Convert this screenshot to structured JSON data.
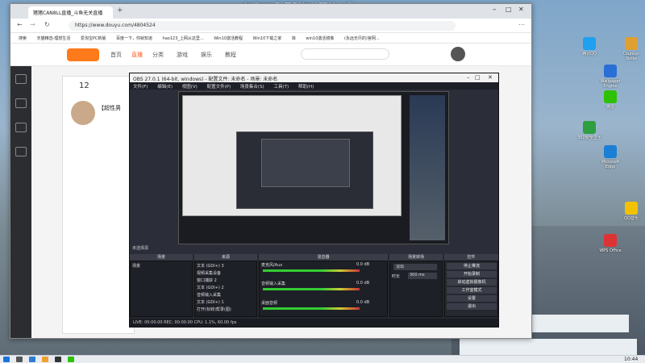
{
  "overlay_text": "在吧WX群里群包分配给大家",
  "browser": {
    "tab_title": "猪猪CAN8LL直播_斗鱼无关直播",
    "url": "https://www.douyu.com/4804524",
    "favorites": [
      "搜索",
      "天猫精选-理想生活",
      "爱淘宝PC新版",
      "百度一下，你就知道",
      "hao123_上网从这里...",
      "Win10激活教程",
      "Win10下载之家",
      "库",
      "win10激活镜像",
      "(永远无尽的)官网..."
    ],
    "nav": [
      "首页",
      "直播",
      "分类",
      "游戏",
      "娱乐",
      "教程"
    ],
    "room_number": "12",
    "room_title": "【超性男"
  },
  "obs": {
    "title": "OBS 27.0.1 (64-bit, windows) - 配置文件: 未命名 - 场景: 未命名",
    "menu": [
      "文件(F)",
      "编辑(E)",
      "视图(V)",
      "配置文件(P)",
      "场景集合(S)",
      "工具(T)",
      "帮助(H)"
    ],
    "no_source": "未选择源",
    "panels": {
      "scenes": "场景",
      "sources": "来源",
      "mixer": "混音器",
      "transitions": "场景转场",
      "controls": "控件"
    },
    "scene_name": "场景",
    "sources": [
      "文本 (GDI+) 3",
      "视频采集设备",
      "窗口捕获 2",
      "文本 (GDI+) 2",
      "音频输入采集",
      "文本 (GDI+) 1",
      "打开(标转)帮录(图)"
    ],
    "mixer_tracks": [
      {
        "name": "桌面音频",
        "db": "0.0 dB"
      },
      {
        "name": "麦克风/Aux",
        "db": "0.0 dB"
      },
      {
        "name": "音频输入采集",
        "db": "0.0 dB"
      }
    ],
    "transition": "淡出",
    "duration_label": "时长",
    "duration_value": "300 ms",
    "controls": [
      "停止推流",
      "开始录制",
      "启动虚拟摄像机",
      "工作室模式",
      "设置",
      "退出"
    ],
    "status": "LIVE: 00:00:00   REC: 00:00:00   CPU: 1.1%, 60.00 fps"
  },
  "desktop_icons": [
    {
      "label": "Counter-Strike",
      "color": "#e0a030"
    },
    {
      "label": "腾讯QQ",
      "color": "#1fa0f0"
    },
    {
      "label": "Wallpaper Engine",
      "color": "#2a6fd6"
    },
    {
      "label": "微信",
      "color": "#2dc100"
    },
    {
      "label": "360安全卫士",
      "color": "#2e9e3e"
    },
    {
      "label": "Microsoft Edge",
      "color": "#1b7fd6"
    },
    {
      "label": "QQ音乐",
      "color": "#f2c200"
    },
    {
      "label": "WPS Office",
      "color": "#d33"
    }
  ],
  "clock": "10:44"
}
